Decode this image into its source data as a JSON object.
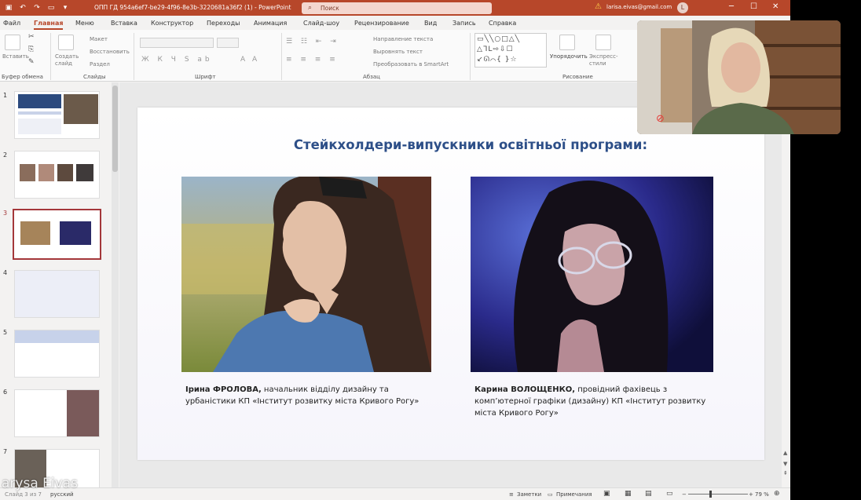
{
  "titlebar": {
    "file_name": "ОПП ГД 954a6ef7-be29-4f96-8e3b-3220681a36f2 (1)  -  PowerPoint",
    "search_placeholder": "Поиск",
    "user_email": "larisa.eivas@gmail.com",
    "avatar_letter": "L",
    "icons": [
      "save-icon",
      "undo-icon",
      "redo-icon",
      "customize-icon"
    ]
  },
  "menu": {
    "tabs": [
      "Файл",
      "Главная",
      "Меню",
      "Вставка",
      "Конструктор",
      "Переходы",
      "Анимация",
      "Слайд-шоу",
      "Рецензирование",
      "Вид",
      "Запись",
      "Справка"
    ],
    "active_tab": "Главная"
  },
  "ribbon": {
    "paste_label": "Вставить",
    "new_slide_label": "Создать слайд",
    "layout_label": "Макет",
    "reset_label": "Восстановить",
    "section_label": "Раздел",
    "text_direction_label": "Направление текста",
    "align_text_label": "Выровнять текст",
    "smartart_label": "Преобразовать в SmartArt",
    "arrange_label": "Упорядочить",
    "quick_styles_label": "Экспресс-стили",
    "groups": {
      "clipboard": "Буфер обмена",
      "slides": "Слайды",
      "font": "Шрифт",
      "paragraph": "Абзац",
      "drawing": "Рисование"
    }
  },
  "thumbnails": {
    "numbers": [
      "1",
      "2",
      "3",
      "4",
      "5",
      "6",
      "7"
    ],
    "selected": 3
  },
  "slide": {
    "title": "Стейкхолдери-випускники освітньої програми:",
    "left_person": {
      "name": "Ірина ФРОЛОВА,",
      "desc": " начальник відділу дизайну та урбаністики КП «Інститут розвитку міста Кривого Рогу»"
    },
    "right_person": {
      "name": "Карина ВОЛОЩЕНКО,",
      "desc": " провідний фахівець з комп’ютерної графіки (дизайну) КП «Інститут розвитку міста Кривого Рогу»"
    }
  },
  "webcam": {
    "participant": "Larysa Eivas"
  },
  "statusbar": {
    "slide_info": "Слайд 3 из 7",
    "language": "русский",
    "notes_label": "Заметки",
    "comments_label": "Примечания",
    "zoom": "79 %",
    "overlay_name": "arysa Eivas"
  },
  "colors": {
    "accent": "#b7472a",
    "slide_title": "#2d4f88",
    "selection": "#a4373a"
  }
}
